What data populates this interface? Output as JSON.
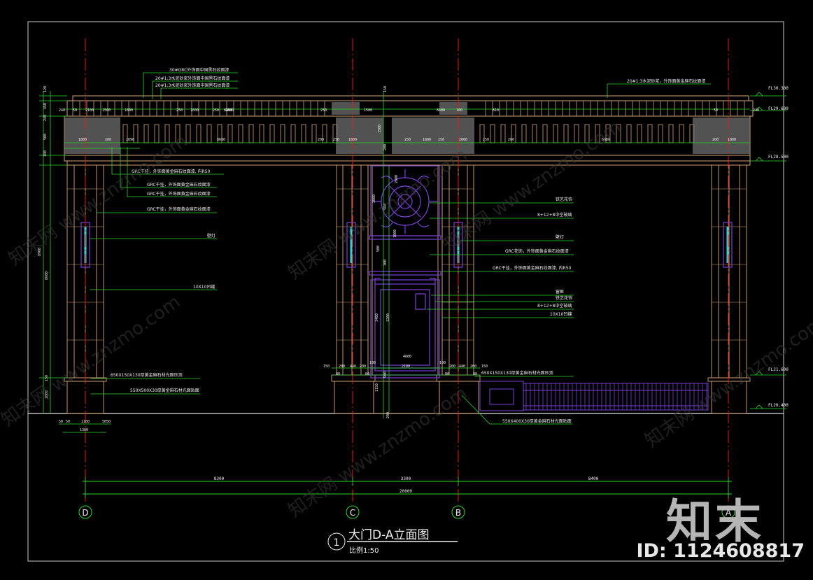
{
  "title": {
    "circle_number": "1",
    "name": "大门D-A立面图",
    "scale": "比例1:50"
  },
  "axes": [
    {
      "label": "D"
    },
    {
      "label": "C"
    },
    {
      "label": "B"
    },
    {
      "label": "A"
    }
  ],
  "overall_dims": {
    "spans": [
      "8300",
      "3300",
      "8400"
    ],
    "total": "20000"
  },
  "elevations": [
    "FL30.300",
    "FL29.600",
    "FL28.500",
    "FL21.600",
    "FL20.400"
  ],
  "left_leaders": [
    "30#GRC外饰面中国黑石纹面漆",
    "20#1:3水泥砂浆外饰面中国黑石纹面漆",
    "20#1:3水泥砂浆外饰面中国黑石纹面漆",
    "GRC干挂，外饰面黄金麻石纹面漆, 内R50",
    "GRC干挂，外饰面黄金麻石纹面漆",
    "GRC干挂，外饰面黄金麻石纹面漆",
    "GRC干挂，外饰面黄金麻石纹面漆",
    "壁灯",
    "10X10凹缝",
    "650X150X130厚黄金麻石材光面压顶",
    "550X500X30厚黄金麻石材光面贴面"
  ],
  "right_leaders": [
    "20#1:3水泥砂浆，外饰面黄金麻石纹面漆",
    "铁艺花饰",
    "8+12+8中空玻璃",
    "壁灯",
    "GRC花饰，外饰面黄金麻石纹面漆",
    "GRC干挂，外饰面黄金麻石纹面漆, 内R50",
    "窗框",
    "铁艺花饰",
    "8+12+8中空玻璃",
    "10X10凹缝",
    "650X150X130厚黄金麻石材光面压顶",
    "550X400X30厚黄金麻石材光面贴面"
  ],
  "top_dims": [
    "240",
    "50",
    "2100",
    "1500",
    "8400",
    "1600",
    "250",
    "1600",
    "250",
    "1600",
    "250",
    "1500",
    "8400",
    "100",
    "810",
    "50",
    "240"
  ],
  "frieze_dims": [
    "1800",
    "2090",
    "200",
    "8680",
    "200",
    "250",
    "1800",
    "250",
    "1800",
    "250",
    "2000",
    "250",
    "200",
    "6680",
    "200",
    "1800"
  ],
  "left_vertical_dims": [
    "120",
    "450",
    "240",
    "900",
    "100",
    "8900",
    "8600",
    "150",
    "1000"
  ],
  "center_vertical_dims": [
    "150",
    "1500",
    "200",
    "2000",
    "2800",
    "900",
    "500",
    "300",
    "1000",
    "3400",
    "3200",
    "900",
    "1150",
    "200"
  ],
  "base_dims": [
    "150",
    "200",
    "440",
    "200",
    "100",
    "4600",
    "2100",
    "100",
    "200",
    "440",
    "200",
    "150",
    "80",
    "80",
    "80",
    "80"
  ],
  "bottom_left_dims": [
    "50",
    "50",
    "1100",
    "50",
    "50",
    "1300"
  ],
  "branding": {
    "logo_text": "知末",
    "id_text": "ID: 1124608817",
    "watermark": "知末网 www.znzmo.com"
  },
  "colors": {
    "background": "#000000",
    "frame": "#c9c9c9",
    "stone": "#d4a474",
    "axis": "#e8161a",
    "dimension": "#2ad62a",
    "ornament": "#7a3fd8",
    "lamp": "#37d1d6",
    "label": "#f0f0f0"
  }
}
